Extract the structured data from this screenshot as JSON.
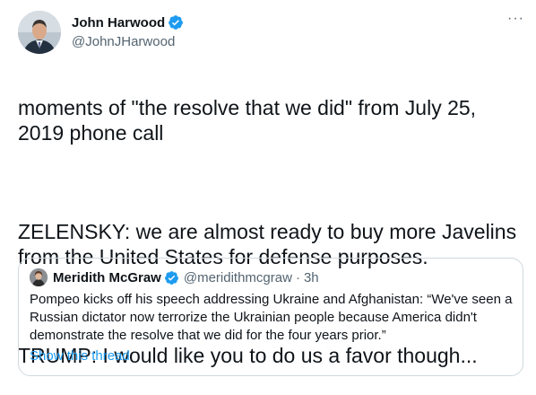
{
  "tweet": {
    "author": {
      "display_name": "John Harwood",
      "handle": "@JohnJHarwood",
      "verified": true,
      "avatar_icon": "person-portrait-icon"
    },
    "more_label": "···",
    "paragraphs": [
      "moments of \"the resolve that we did\" from July 25, 2019 phone call",
      "ZELENSKY: we are almost ready to buy more Javelins from the United States for defense purposes.",
      "TRUMP: I would like you to do us a favor though..."
    ]
  },
  "quote": {
    "author": {
      "display_name": "Meridith McGraw",
      "handle": "@meridithmcgraw",
      "separator": "·",
      "time": "3h",
      "verified": true
    },
    "text": "Pompeo kicks off his speech addressing Ukraine and Afghanistan: “We've seen a Russian dictator now terrorize the Ukrainian people because America didn't demonstrate the resolve that we did for the four years prior.”",
    "show_thread": "Show this thread"
  },
  "colors": {
    "verified_blue": "#1d9bf0",
    "link_blue": "#1d9bf0",
    "secondary_text": "#536471",
    "border": "#cfd9de"
  }
}
